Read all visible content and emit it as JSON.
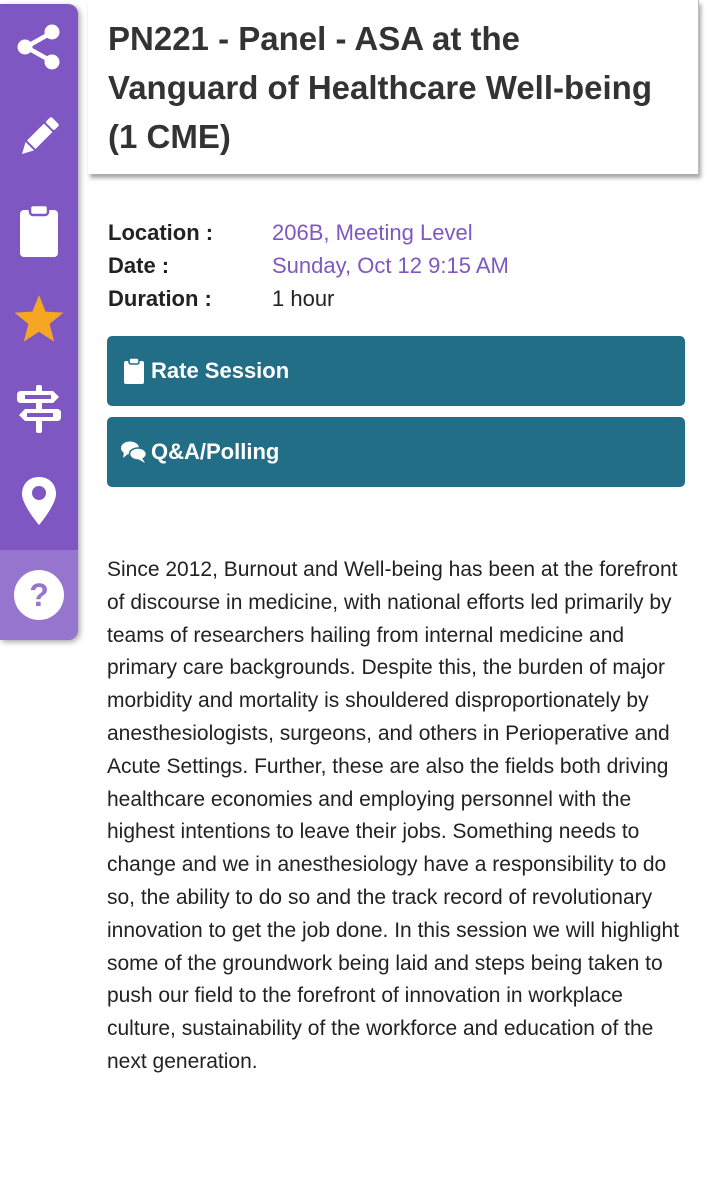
{
  "session": {
    "title": "PN221 - Panel - ASA at the Vanguard of Healthcare Well-being (1 CME)",
    "details": {
      "location_label": "Location :",
      "location_value": "206B, Meeting Level",
      "date_label": "Date :",
      "date_value": "Sunday, Oct 12 9:15 AM",
      "duration_label": "Duration :",
      "duration_value": "1 hour"
    },
    "buttons": {
      "rate_label": "Rate Session",
      "rate_icon": "clipboard-icon",
      "qa_label": "Q&A/Polling",
      "qa_icon": "chat-bubbles-icon"
    },
    "description": "Since 2012, Burnout and Well-being has been at the forefront of discourse in medicine, with national efforts led primarily by teams of researchers hailing from internal medicine and primary care backgrounds. Despite this, the burden of major morbidity and mortality is shouldered disproportionately by anesthesiologists, surgeons, and others in Perioperative and Acute Settings. Further, these are also the fields both driving healthcare economies and employing personnel with the highest intentions to leave their jobs. Something needs to change and we in anesthesiology have a responsibility to do so, the ability to do so and the track record of revolutionary innovation to get the job done. In this session we will highlight some of the groundwork being laid and steps being taken to push our field to the forefront of innovation in workplace culture, sustainability of the workforce and education of the next generation."
  },
  "sidebar": {
    "icons": [
      "share-icon",
      "pencil-icon",
      "clipboard-icon",
      "star-icon",
      "signpost-icon",
      "map-pin-icon",
      "help-icon"
    ],
    "star_color": "#f5a623"
  },
  "colors": {
    "rail": "#7e57c2",
    "rail_help": "#9575cd",
    "button": "#226e87",
    "link": "#7e57c2"
  }
}
